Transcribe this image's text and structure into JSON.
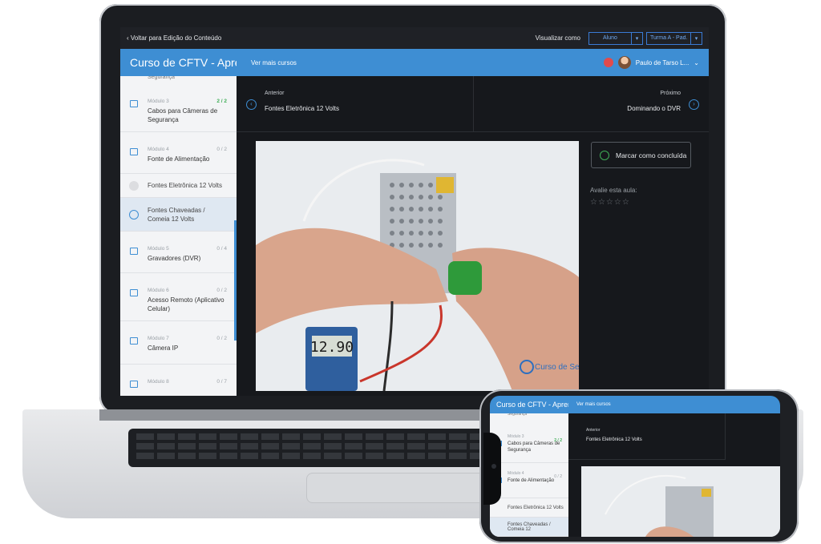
{
  "topbar": {
    "back_label": "Voltar para Edição do Conteúdo",
    "view_as_label": "Visualizar como",
    "role_select": "Aluno",
    "class_select": "Turma A - Pad..."
  },
  "header": {
    "course_title": "Curso de CFTV - Aprend",
    "more_courses": "Ver mais cursos",
    "user_name": "Paulo de Tarso L..."
  },
  "sidebar": {
    "cut_text": "Segurança",
    "module3": {
      "label": "Módulo 3",
      "count": "2 / 2",
      "title": "Cabos para Câmeras de Segurança"
    },
    "module4": {
      "label": "Módulo 4",
      "count": "0 / 2",
      "title": "Fonte de Alimentação"
    },
    "lesson1": "Fontes Eletrônica 12 Volts",
    "lesson2": "Fontes Chaveadas / Comeia 12 Volts",
    "module5": {
      "label": "Módulo 5",
      "count": "0 / 4",
      "title": "Gravadores (DVR)"
    },
    "module6": {
      "label": "Módulo 6",
      "count": "0 / 2",
      "title": "Acesso Remoto (Aplicativo Celular)"
    },
    "module7": {
      "label": "Módulo 7",
      "count": "0 / 2",
      "title": "Câmera IP"
    },
    "module8": {
      "label": "Módulo 8",
      "count": "0 / 7",
      "title": ""
    }
  },
  "navigation": {
    "prev_label": "Anterior",
    "prev_title": "Fontes Eletrônica 12 Volts",
    "next_label": "Próximo",
    "next_title": "Dominando o DVR"
  },
  "video": {
    "multimeter_reading": "12.90",
    "watermark": "Curso de Segurança"
  },
  "actions": {
    "mark_complete": "Marcar como concluída",
    "rate_label": "Avalie esta aula:",
    "stars": "☆☆☆☆☆"
  },
  "phone": {
    "course_title": "Curso de CFTV - Aprend",
    "more_courses": "Ver mais cursos",
    "cut_text": "Segurança",
    "module3": {
      "label": "Módulo 3",
      "count": "2 / 2",
      "title": "Cabos para Câmeras de Segurança"
    },
    "module4": {
      "label": "Módulo 4",
      "count": "0 / 2",
      "title": "Fonte de Alimentação"
    },
    "lesson1": "Fontes Eletrônica 12 Volts",
    "lesson2": "Fontes Chaveadas / Comeia 12",
    "prev_label": "Anterior",
    "prev_title": "Fontes Eletrônica 12 Volts"
  },
  "colors": {
    "accent": "#3e8ed3",
    "success": "#3fae57",
    "dark_bg": "#16181c"
  }
}
